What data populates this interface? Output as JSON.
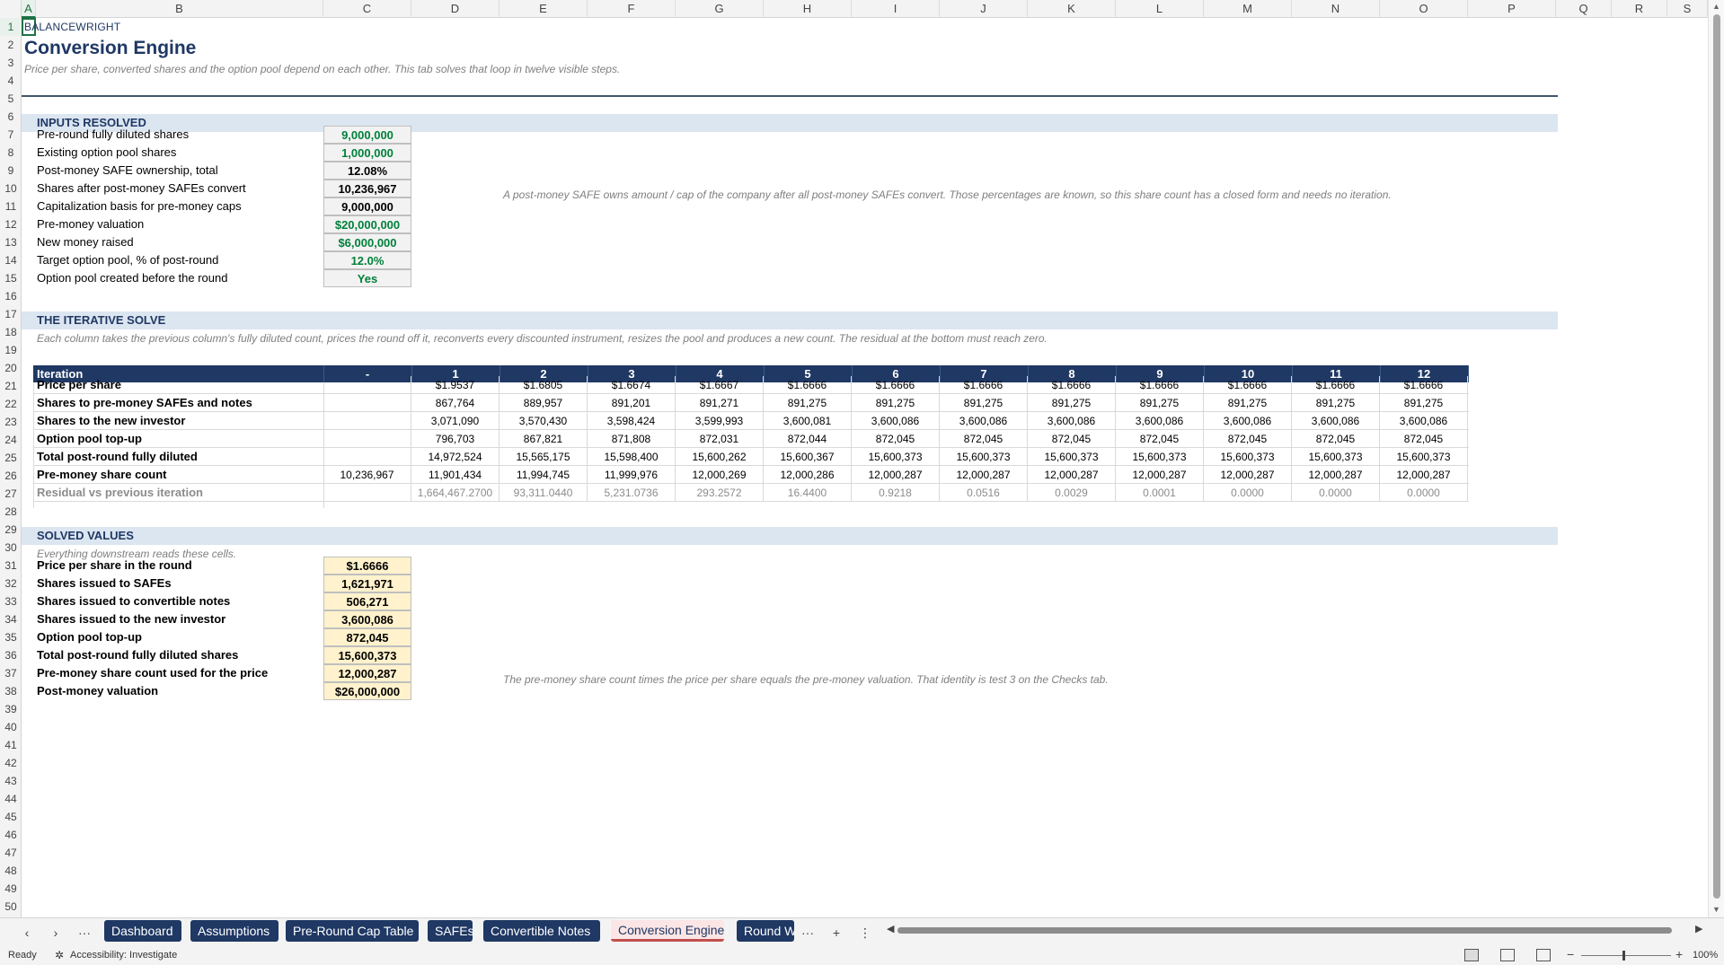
{
  "columns": [
    "A",
    "B",
    "C",
    "D",
    "E",
    "F",
    "G",
    "H",
    "I",
    "J",
    "K",
    "L",
    "M",
    "N",
    "O",
    "P",
    "Q",
    "R",
    "S"
  ],
  "rows": [
    "1",
    "2",
    "3",
    "4",
    "5",
    "6",
    "7",
    "8",
    "9",
    "10",
    "11",
    "12",
    "13",
    "14",
    "15",
    "16",
    "17",
    "18",
    "19",
    "20",
    "21",
    "22",
    "23",
    "24",
    "25",
    "26",
    "27",
    "28",
    "29",
    "30",
    "31",
    "32",
    "33",
    "34",
    "35",
    "36",
    "37",
    "38",
    "39",
    "40",
    "41",
    "42",
    "43",
    "44",
    "45",
    "46",
    "47",
    "48",
    "49",
    "50"
  ],
  "brand": "BALANCEWRIGHT",
  "title": "Conversion Engine",
  "subtitle": "Price per share, converted shares and the option pool depend on each other. This tab solves that loop in twelve visible steps.",
  "inputs": {
    "heading": "INPUTS RESOLVED",
    "items": [
      {
        "label": "Pre-round fully diluted shares",
        "value": "9,000,000",
        "color": "green"
      },
      {
        "label": "Existing option pool shares",
        "value": "1,000,000",
        "color": "green"
      },
      {
        "label": "Post-money SAFE ownership, total",
        "value": "12.08%",
        "color": "black"
      },
      {
        "label": "Shares after post-money SAFEs convert",
        "value": "10,236,967",
        "color": "black"
      },
      {
        "label": "Capitalization basis for pre-money caps",
        "value": "9,000,000",
        "color": "black"
      },
      {
        "label": "Pre-money valuation",
        "value": "$20,000,000",
        "color": "green"
      },
      {
        "label": "New money raised",
        "value": "$6,000,000",
        "color": "green"
      },
      {
        "label": "Target option pool, % of post-round",
        "value": "12.0%",
        "color": "green"
      },
      {
        "label": "Option pool created before the round",
        "value": "Yes",
        "color": "green"
      }
    ],
    "note": "A post-money SAFE owns amount / cap of the company after all post-money SAFEs convert. Those percentages are known, so this share count has a closed form and needs no iteration."
  },
  "iterative": {
    "heading": "THE ITERATIVE SOLVE",
    "description": "Each column takes the previous column's fully diluted count, prices the round off it, reconverts every discounted instrument, resizes the pool and produces a new count. The residual at the bottom must reach zero.",
    "header_label": "Iteration",
    "columns": [
      "-",
      "1",
      "2",
      "3",
      "4",
      "5",
      "6",
      "7",
      "8",
      "9",
      "10",
      "11",
      "12"
    ],
    "rows": [
      {
        "label": "Price per share",
        "values": [
          "",
          "$1.9537",
          "$1.6805",
          "$1.6674",
          "$1.6667",
          "$1.6666",
          "$1.6666",
          "$1.6666",
          "$1.6666",
          "$1.6666",
          "$1.6666",
          "$1.6666",
          "$1.6666"
        ]
      },
      {
        "label": "Shares to pre-money SAFEs and notes",
        "values": [
          "",
          "867,764",
          "889,957",
          "891,201",
          "891,271",
          "891,275",
          "891,275",
          "891,275",
          "891,275",
          "891,275",
          "891,275",
          "891,275",
          "891,275"
        ]
      },
      {
        "label": "Shares to the new investor",
        "values": [
          "",
          "3,071,090",
          "3,570,430",
          "3,598,424",
          "3,599,993",
          "3,600,081",
          "3,600,086",
          "3,600,086",
          "3,600,086",
          "3,600,086",
          "3,600,086",
          "3,600,086",
          "3,600,086"
        ]
      },
      {
        "label": "Option pool top-up",
        "values": [
          "",
          "796,703",
          "867,821",
          "871,808",
          "872,031",
          "872,044",
          "872,045",
          "872,045",
          "872,045",
          "872,045",
          "872,045",
          "872,045",
          "872,045"
        ]
      },
      {
        "label": "Total post-round fully diluted",
        "values": [
          "",
          "14,972,524",
          "15,565,175",
          "15,598,400",
          "15,600,262",
          "15,600,367",
          "15,600,373",
          "15,600,373",
          "15,600,373",
          "15,600,373",
          "15,600,373",
          "15,600,373",
          "15,600,373"
        ]
      },
      {
        "label": "Pre-money share count",
        "values": [
          "10,236,967",
          "11,901,434",
          "11,994,745",
          "11,999,976",
          "12,000,269",
          "12,000,286",
          "12,000,287",
          "12,000,287",
          "12,000,287",
          "12,000,287",
          "12,000,287",
          "12,000,287",
          "12,000,287"
        ]
      },
      {
        "label": "Residual vs previous iteration",
        "values": [
          "",
          "1,664,467.2700",
          "93,311.0440",
          "5,231.0736",
          "293.2572",
          "16.4400",
          "0.9218",
          "0.0516",
          "0.0029",
          "0.0001",
          "0.0000",
          "0.0000",
          "0.0000"
        ],
        "muted": true
      }
    ]
  },
  "solved": {
    "heading": "SOLVED VALUES",
    "note": "Everything downstream reads these cells.",
    "items": [
      {
        "label": "Price per share in the round",
        "value": "$1.6666"
      },
      {
        "label": "Shares issued to SAFEs",
        "value": "1,621,971"
      },
      {
        "label": "Shares issued to convertible notes",
        "value": "506,271"
      },
      {
        "label": "Shares issued to the new investor",
        "value": "3,600,086"
      },
      {
        "label": "Option pool top-up",
        "value": "872,045"
      },
      {
        "label": "Total post-round fully diluted shares",
        "value": "15,600,373"
      },
      {
        "label": "Pre-money share count used for the price",
        "value": "12,000,287"
      },
      {
        "label": "Post-money valuation",
        "value": "$26,000,000"
      }
    ],
    "identity_note": "The pre-money share count times the price per share equals the pre-money valuation. That identity is test 3 on the Checks tab."
  },
  "tabs": [
    "Dashboard",
    "Assumptions",
    "Pre-Round Cap Table",
    "SAFEs",
    "Convertible Notes",
    "Conversion Engine",
    "Round W"
  ],
  "active_tab": "Conversion Engine",
  "tabbar": {
    "prev": "‹",
    "next": "›",
    "more": "···",
    "add": "+",
    "options": "⋮"
  },
  "status": {
    "ready": "Ready",
    "accessibility": "Accessibility: Investigate",
    "zoom": "100%"
  },
  "colors": {
    "navy": "#1f3864",
    "band": "#dce6f1",
    "input_green": "#00803a",
    "solved_fill": "#fff2cc",
    "active_tab_underline": "#c0504d"
  }
}
